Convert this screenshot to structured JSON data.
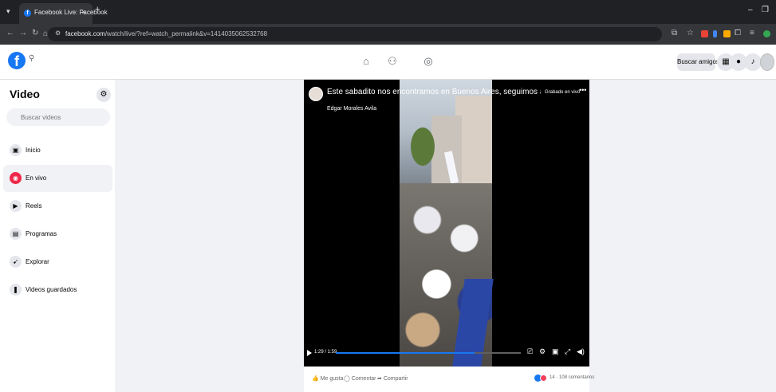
{
  "browser": {
    "tab_title": "Facebook Live: Facebook",
    "tab_close": "×",
    "new_tab": "+",
    "url_domain": "facebook.com",
    "url_path": "/watch/live/?ref=watch_permalink&v=1414035062532768",
    "window_min": "–",
    "window_max": "❐"
  },
  "facebook": {
    "find_friends": "Buscar amigos"
  },
  "sidebar": {
    "title": "Video",
    "search_placeholder": "Buscar videos",
    "items": [
      {
        "label": "Inicio",
        "icon": "video-home-icon",
        "active": false
      },
      {
        "label": "En vivo",
        "icon": "live-icon",
        "active": true
      },
      {
        "label": "Reels",
        "icon": "reels-icon",
        "active": false
      },
      {
        "label": "Programas",
        "icon": "shows-icon",
        "active": false
      },
      {
        "label": "Explorar",
        "icon": "explore-icon",
        "active": false
      },
      {
        "label": "Videos guardados",
        "icon": "bookmark-icon",
        "active": false
      }
    ]
  },
  "video": {
    "title": "Este sabadito nos encontramos en Buenos Aires, seguimos avanzando, reafirm...",
    "recorded": "Grabado en vivo",
    "author": "Edgar Morales Avila",
    "time": "1:29 / 1:59",
    "progress": 0.75
  },
  "actions": {
    "like": "Me gusta",
    "comment": "Comentar",
    "share": "Compartir",
    "reactions_count": "14",
    "comments_count": "108 comentarios"
  },
  "colors": {
    "brand": "#1877f2",
    "live": "#f02849"
  }
}
